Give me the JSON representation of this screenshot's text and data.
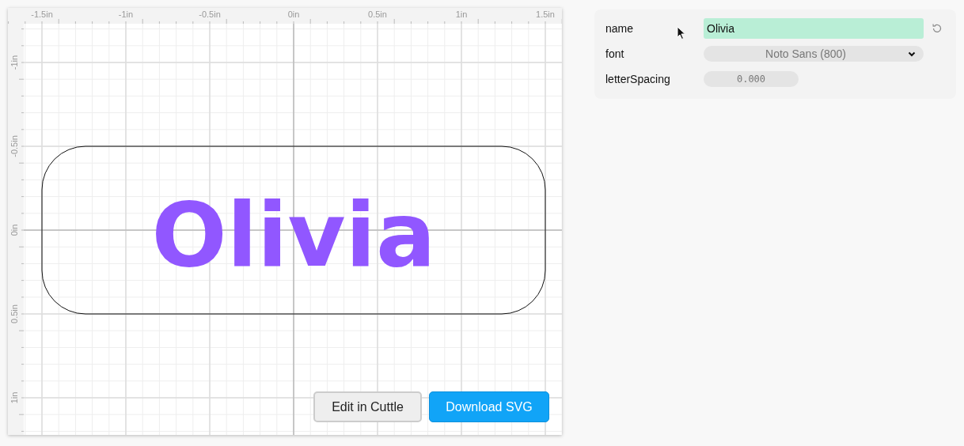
{
  "canvas": {
    "x_ruler": [
      "-1.5in",
      "-1in",
      "-0.5in",
      "0in",
      "0.5in",
      "1in",
      "1.5in"
    ],
    "y_ruler": [
      "-1in",
      "-0.5in",
      "0in",
      "0.5in",
      "1in"
    ],
    "design_text": "Olivia"
  },
  "buttons": [
    {
      "label": "Edit in Cuttle",
      "kind": "secondary"
    },
    {
      "label": "Download SVG",
      "kind": "primary"
    }
  ],
  "params": [
    {
      "label": "name",
      "kind": "text",
      "value": "Olivia"
    },
    {
      "label": "font",
      "kind": "select",
      "value": "Noto Sans (800)"
    },
    {
      "label": "letterSpacing",
      "kind": "number",
      "value": "0.000"
    }
  ]
}
